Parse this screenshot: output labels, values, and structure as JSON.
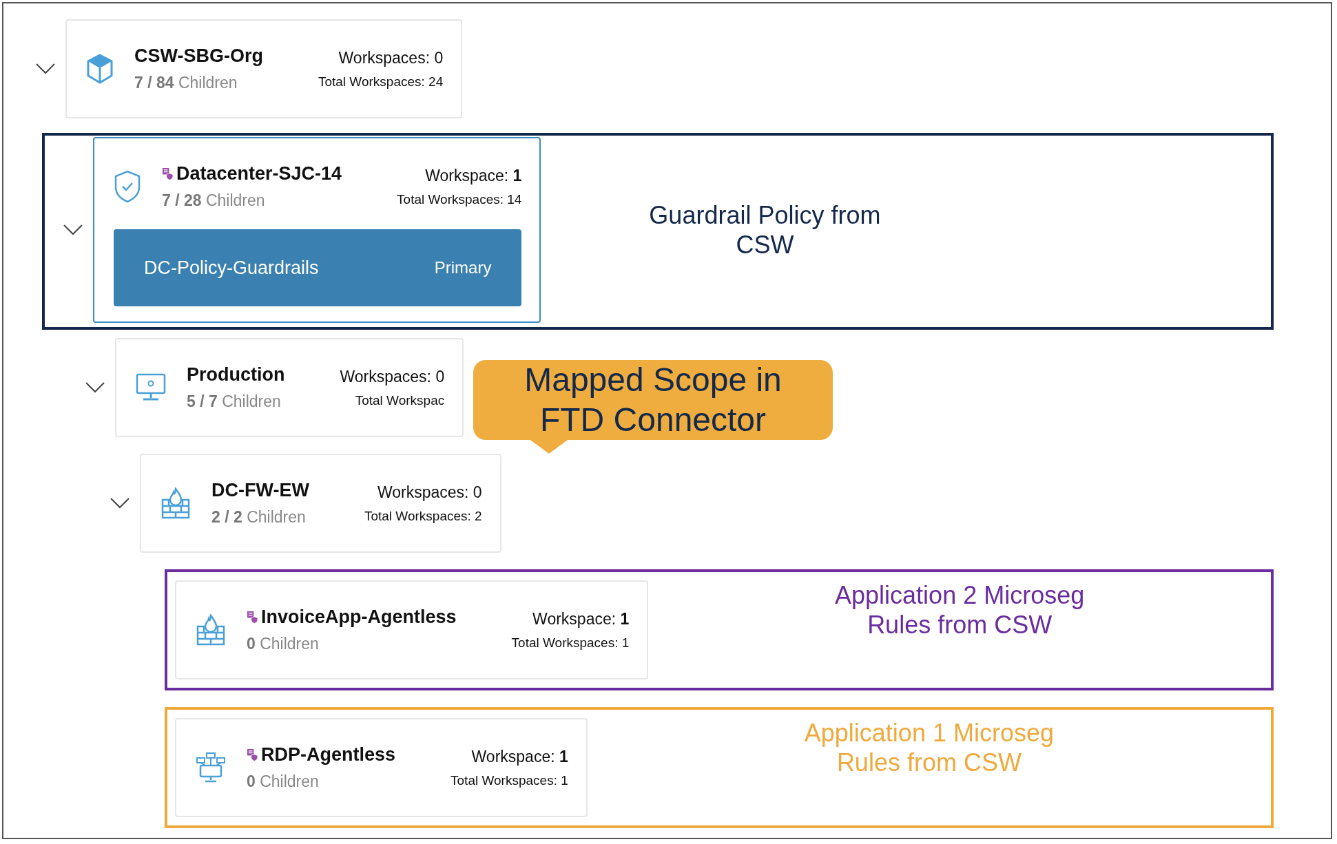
{
  "tree": [
    {
      "title": "CSW-SBG-Org",
      "kind": "cube",
      "policy_badge": false,
      "selected": false,
      "expanded": true,
      "children_count": "**7 / 84** Children",
      "workspaces": "Workspaces: 0",
      "total_workspaces": "Total Workspaces: 24",
      "children": [
        {
          "title": "Datacenter-SJC-14",
          "kind": "shield",
          "policy_badge": true,
          "selected": true,
          "expanded": true,
          "children_count": "**7 / 28** Children",
          "workspaces": "Workspace: **1**",
          "total_workspaces": "Total Workspaces: 14",
          "policy": {
            "name": "DC-Policy-Guardrails",
            "role": "Primary"
          },
          "annotation": {
            "text": "Guardrail Policy from CSW",
            "color": "#14284b"
          },
          "children": [
            {
              "title": "Production",
              "kind": "monitor",
              "policy_badge": false,
              "selected": false,
              "expanded": true,
              "children_count": "**5 / 7** Children",
              "workspaces": "Workspaces: 0",
              "total_workspaces": "Total Workspac",
              "children": [
                {
                  "title": "DC-FW-EW",
                  "kind": "firewall",
                  "policy_badge": false,
                  "selected": false,
                  "expanded": true,
                  "children_count": "**2 / 2** Children",
                  "workspaces": "Workspaces: 0",
                  "total_workspaces": "Total Workspaces: 2",
                  "children": [
                    {
                      "title": "InvoiceApp-Agentless",
                      "kind": "firewall",
                      "policy_badge": true,
                      "selected": false,
                      "children_count": "**0** Children",
                      "workspaces": "Workspace: **1**",
                      "total_workspaces": "Total Workspaces: 1",
                      "annotation": {
                        "text": "Application 2 Microseg Rules from CSW",
                        "color": "#6a2c9e"
                      }
                    },
                    {
                      "title": "RDP-Agentless",
                      "kind": "network",
                      "policy_badge": true,
                      "selected": false,
                      "children_count": "**0** Children",
                      "workspaces": "Workspace: **1**",
                      "total_workspaces": "Total Workspaces: 1",
                      "annotation": {
                        "text": "Application 1 Microseg Rules from CSW",
                        "color": "#efa93c"
                      }
                    }
                  ]
                }
              ]
            }
          ]
        }
      ]
    }
  ],
  "callout": {
    "text": "Mapped Scope in FTD Connector"
  }
}
